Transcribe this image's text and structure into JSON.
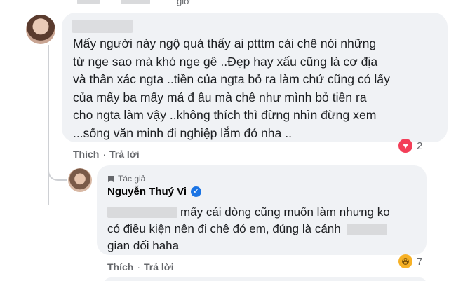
{
  "top": {
    "timestamp_suffix": "giờ"
  },
  "comment1": {
    "text": "Mấy người này ngộ quá thấy ai ptttm cái chê nói những\ntừ nge sao mà khó nge gê ..Đẹp hay xấu cũng là cơ địa\nvà thân xác ngta ..tiền của ngta bỏ ra làm chứ cũng có lấy\ncủa mấy ba mấy má đ âu mà chê như mình bỏ tiền ra\ncho ngta làm vậy ..không thích thì đừng nhìn đừng xem\n...sống văn minh đi nghiệp lắm đó nha ..",
    "like_label": "Thích",
    "separator": "·",
    "reply_label": "Trả lời",
    "reaction_count": "2"
  },
  "reply": {
    "author_tag": "Tác giả",
    "author_name": "Nguyễn Thuý Vi",
    "line1": "mấy cái dòng cũng muốn làm nhưng ko",
    "line2": "có điều kiện nên đi chê đó em, đúng là cánh",
    "line3": "gian dối haha",
    "like_label": "Thích",
    "separator": "·",
    "reply_label": "Trả lời",
    "reaction_count": "7"
  },
  "icons": {
    "reaction1": "love-icon",
    "reaction2": "haha-icon",
    "verified": "verified-badge-icon",
    "author_tag": "author-tag-icon"
  },
  "colors": {
    "bubble": "#f0f2f5",
    "secondary_text": "#65676b",
    "verified": "#1b74e4",
    "love": "#f33e58",
    "haha": "#f7b125"
  }
}
